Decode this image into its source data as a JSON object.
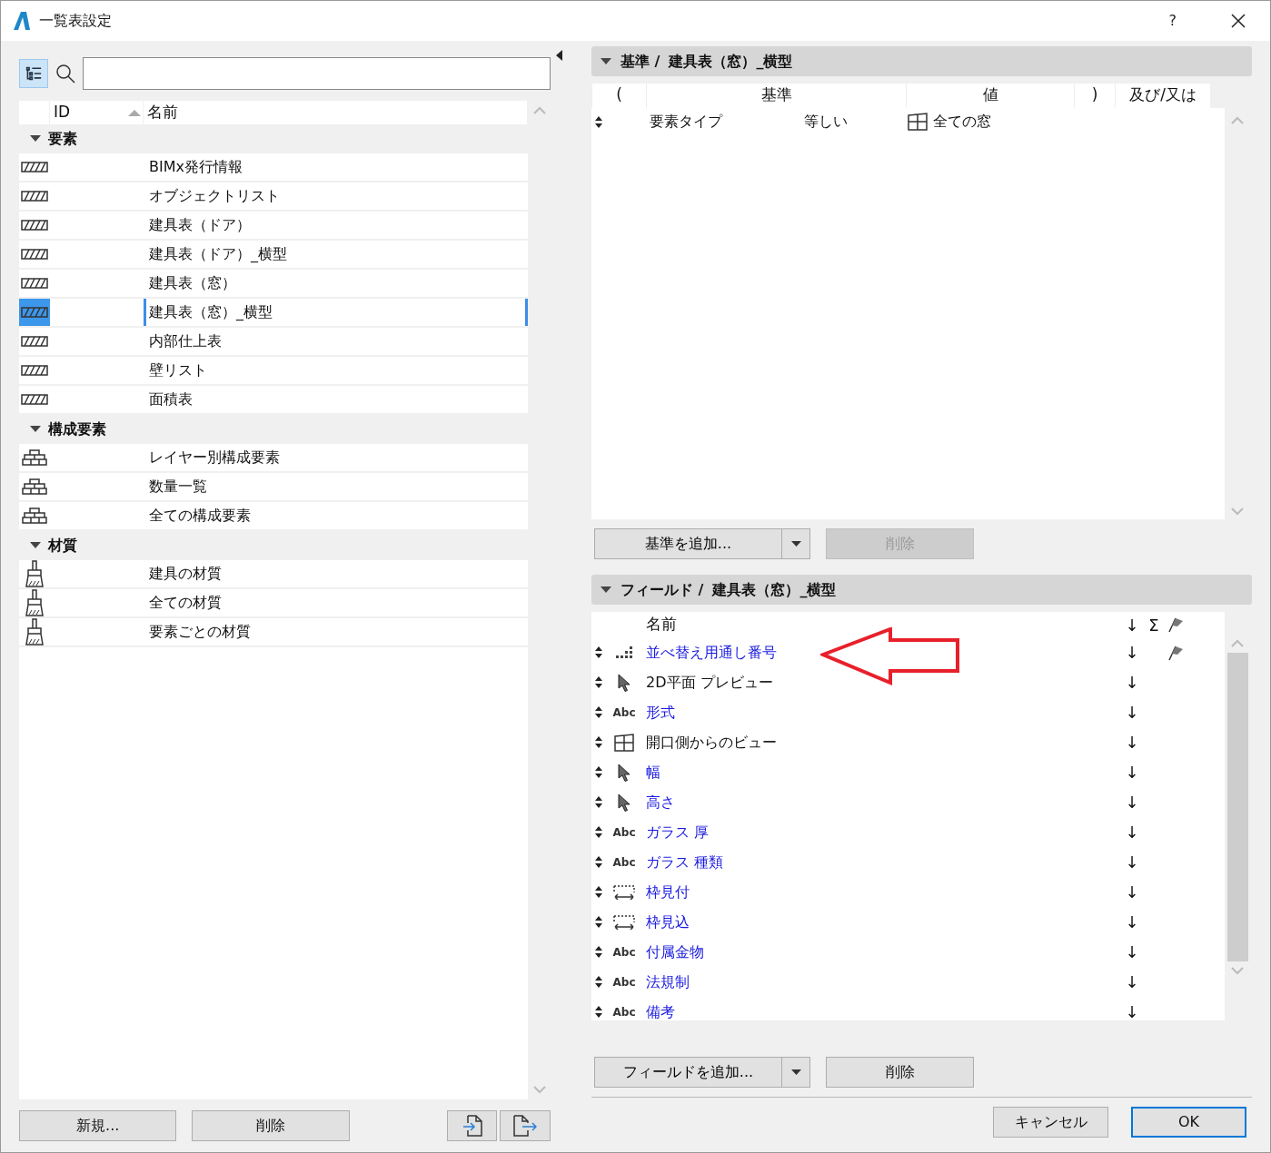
{
  "window": {
    "title": "一覧表設定",
    "help": "?"
  },
  "library": {
    "tree_view_on": true,
    "columns": [
      {
        "label": "ID",
        "sorted": true
      },
      {
        "label": "名前",
        "sorted": false
      }
    ],
    "groups": [
      {
        "name": "要素",
        "expanded": true,
        "items": [
          {
            "name": "BIMx発行情報",
            "kind": "schedule",
            "selected": false
          },
          {
            "name": "オブジェクトリスト",
            "kind": "schedule",
            "selected": false
          },
          {
            "name": "建具表（ドア）",
            "kind": "schedule",
            "selected": false
          },
          {
            "name": "建具表（ドア）_横型",
            "kind": "schedule",
            "selected": false
          },
          {
            "name": "建具表（窓）",
            "kind": "schedule",
            "selected": false
          },
          {
            "name": "建具表（窓）_横型",
            "kind": "schedule",
            "selected": true
          },
          {
            "name": "内部仕上表",
            "kind": "schedule",
            "selected": false
          },
          {
            "name": "壁リスト",
            "kind": "schedule",
            "selected": false
          },
          {
            "name": "面積表",
            "kind": "schedule",
            "selected": false
          }
        ]
      },
      {
        "name": "構成要素",
        "expanded": true,
        "items": [
          {
            "name": "レイヤー別構成要素",
            "kind": "component",
            "selected": false
          },
          {
            "name": "数量一覧",
            "kind": "component",
            "selected": false
          },
          {
            "name": "全ての構成要素",
            "kind": "component",
            "selected": false
          }
        ]
      },
      {
        "name": "材質",
        "expanded": true,
        "items": [
          {
            "name": "建具の材質",
            "kind": "surface",
            "selected": false
          },
          {
            "name": "全ての材質",
            "kind": "surface",
            "selected": false
          },
          {
            "name": "要素ごとの材質",
            "kind": "surface",
            "selected": false
          }
        ]
      }
    ],
    "buttons": {
      "new": "新規...",
      "delete": "削除"
    }
  },
  "criteria": {
    "expanded": true,
    "section": "基準 /",
    "schedule": "建具表（窓）_横型",
    "columns": [
      "(",
      "基準",
      "値",
      ")",
      "及び/又は"
    ],
    "rows": [
      {
        "criterion": "要素タイプ",
        "operator": "等しい",
        "value": "全ての窓"
      }
    ],
    "add_button": "基準を追加...",
    "delete_button": {
      "label": "削除",
      "disabled": true
    }
  },
  "fields": {
    "expanded": true,
    "section": "フィールド /",
    "schedule": "建具表（窓）_横型",
    "columns": {
      "name": "名前",
      "sort": "↓",
      "sum": "Σ"
    },
    "rows": [
      {
        "name": "並べ替え用通し番号",
        "kind": "sequence",
        "linked": true,
        "sort": "↓",
        "flag": true
      },
      {
        "name": "2D平面 プレビュー",
        "kind": "pointer",
        "linked": false,
        "sort": "↓",
        "flag": false
      },
      {
        "name": "形式",
        "kind": "text",
        "type_label": "Abc",
        "linked": true,
        "sort": "↓",
        "flag": false
      },
      {
        "name": "開口側からのビュー",
        "kind": "window",
        "linked": false,
        "sort": "↓",
        "flag": false
      },
      {
        "name": "幅",
        "kind": "pointer",
        "linked": true,
        "sort": "↓",
        "flag": false
      },
      {
        "name": "高さ",
        "kind": "pointer",
        "linked": true,
        "sort": "↓",
        "flag": false
      },
      {
        "name": "ガラス 厚",
        "kind": "text",
        "type_label": "Abc",
        "linked": true,
        "sort": "↓",
        "flag": false
      },
      {
        "name": "ガラス 種類",
        "kind": "text",
        "type_label": "Abc",
        "linked": true,
        "sort": "↓",
        "flag": false
      },
      {
        "name": "枠見付",
        "kind": "dimension",
        "linked": true,
        "sort": "↓",
        "flag": false
      },
      {
        "name": "枠見込",
        "kind": "dimension",
        "linked": true,
        "sort": "↓",
        "flag": false
      },
      {
        "name": "付属金物",
        "kind": "text",
        "type_label": "Abc",
        "linked": true,
        "sort": "↓",
        "flag": false
      },
      {
        "name": "法規制",
        "kind": "text",
        "type_label": "Abc",
        "linked": true,
        "sort": "↓",
        "flag": false
      },
      {
        "name": "備考",
        "kind": "text",
        "type_label": "Abc",
        "linked": true,
        "sort": "↓",
        "flag": false
      }
    ],
    "add_button": "フィールドを追加...",
    "delete_button": {
      "label": "削除",
      "disabled": false
    }
  },
  "footer": {
    "cancel": "キャンセル",
    "ok": {
      "label": "OK",
      "default": true
    }
  }
}
